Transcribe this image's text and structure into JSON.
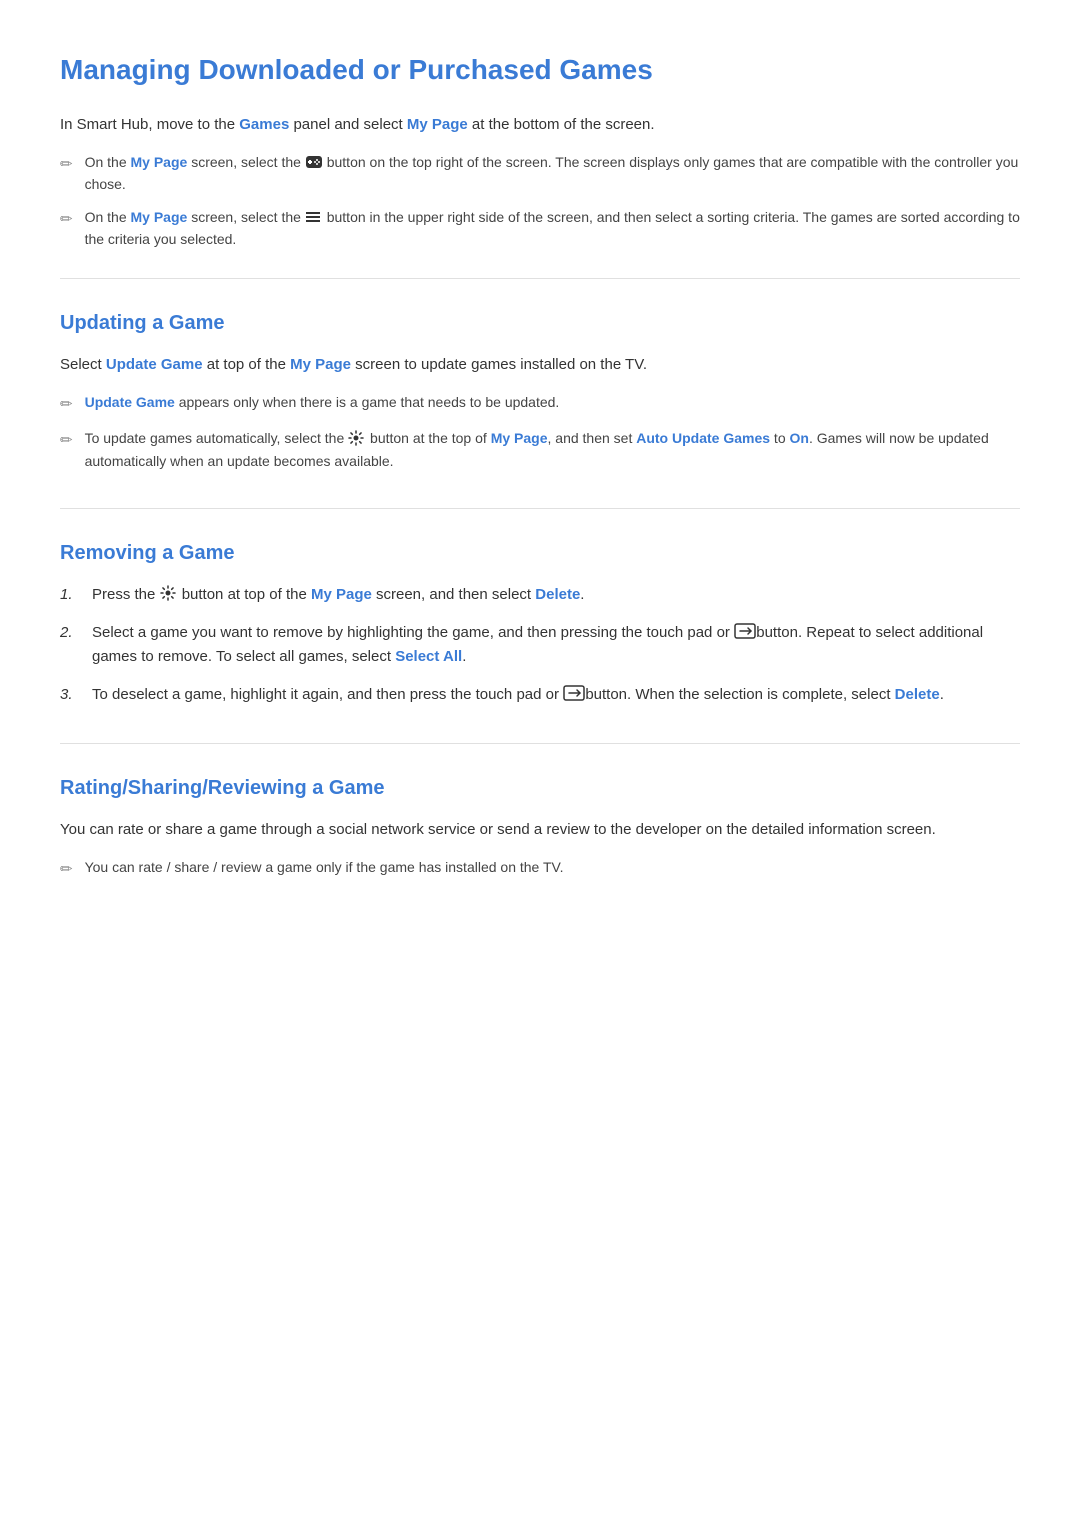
{
  "page": {
    "title": "Managing Downloaded or Purchased Games"
  },
  "intro": {
    "text_before": "In Smart Hub, move to the ",
    "games_link": "Games",
    "text_middle": " panel and select ",
    "my_page_link": "My Page",
    "text_after": " at the bottom of the screen."
  },
  "intro_notes": [
    {
      "text_before": "On the ",
      "my_page_link": "My Page",
      "text_after": " screen, select the [gamepad] button on the top right of the screen. The screen displays only games that are compatible with the controller you chose."
    },
    {
      "text_before": "On the ",
      "my_page_link": "My Page",
      "text_after": " screen, select the [menu] button in the upper right side of the screen, and then select a sorting criteria. The games are sorted according to the criteria you selected."
    }
  ],
  "sections": [
    {
      "id": "updating",
      "title": "Updating a Game",
      "intro_before": "Select ",
      "intro_link1": "Update Game",
      "intro_middle": " at top of the ",
      "intro_link2": "My Page",
      "intro_after": " screen to update games installed on the TV.",
      "notes": [
        {
          "text_before": "",
          "link": "Update Game",
          "text_after": " appears only when there is a game that needs to be updated."
        },
        {
          "text_before": "To update games automatically, select the [gear] button at the top of ",
          "link1": "My Page",
          "text_middle": ", and then set ",
          "link2": "Auto Update Games",
          "text_after": " to ",
          "link3": "On",
          "text_end": ". Games will now be updated automatically when an update becomes available."
        }
      ]
    },
    {
      "id": "removing",
      "title": "Removing a Game",
      "steps": [
        {
          "num": "1.",
          "text_before": "Press the [gear] button at top of the ",
          "link1": "My Page",
          "text_middle": " screen, and then select ",
          "link2": "Delete",
          "text_after": "."
        },
        {
          "num": "2.",
          "text_before": "Select a game you want to remove by highlighting the game, and then pressing the touch pad or [touchpad] button. Repeat to select additional games to remove. To select all games, select ",
          "link": "Select All",
          "text_after": "."
        },
        {
          "num": "3.",
          "text_before": "To deselect a game, highlight it again, and then press the touch pad or [touchpad] button. When the selection is complete, select ",
          "link": "Delete",
          "text_after": "."
        }
      ]
    },
    {
      "id": "rating",
      "title": "Rating/Sharing/Reviewing a Game",
      "intro": "You can rate or share a game through a social network service or send a review to the developer on the detailed information screen.",
      "notes": [
        {
          "text": "You can rate / share / review a game only if the game has installed on the TV."
        }
      ]
    }
  ]
}
